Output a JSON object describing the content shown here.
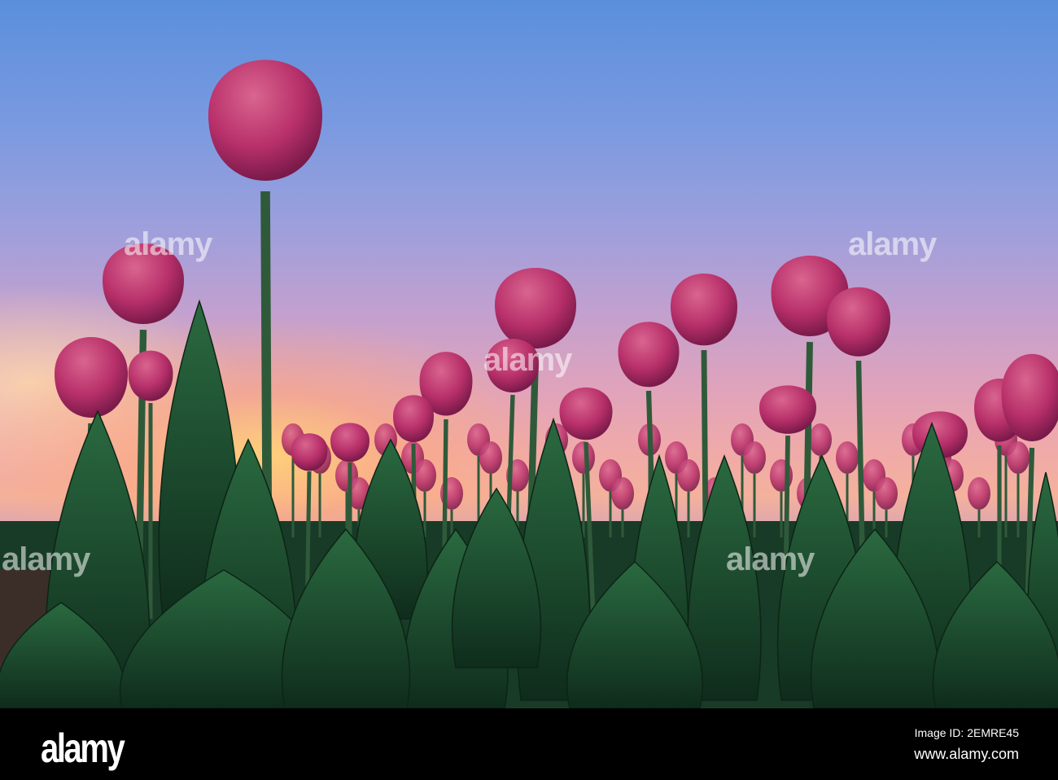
{
  "photo": {
    "subject": "tulips",
    "colors": {
      "sky_top": "#5a8fdc",
      "sky_glow": "#f4b19c",
      "petal": "#b8306a",
      "petal_light": "#d9658f",
      "leaf": "#1f5a35",
      "stem": "#2f5a3a"
    }
  },
  "watermark": {
    "text": "alamy",
    "letter": "a"
  },
  "footer": {
    "logo": "alamy",
    "image_id": "Image ID: 2EMRE45",
    "url": "www.alamy.com"
  }
}
